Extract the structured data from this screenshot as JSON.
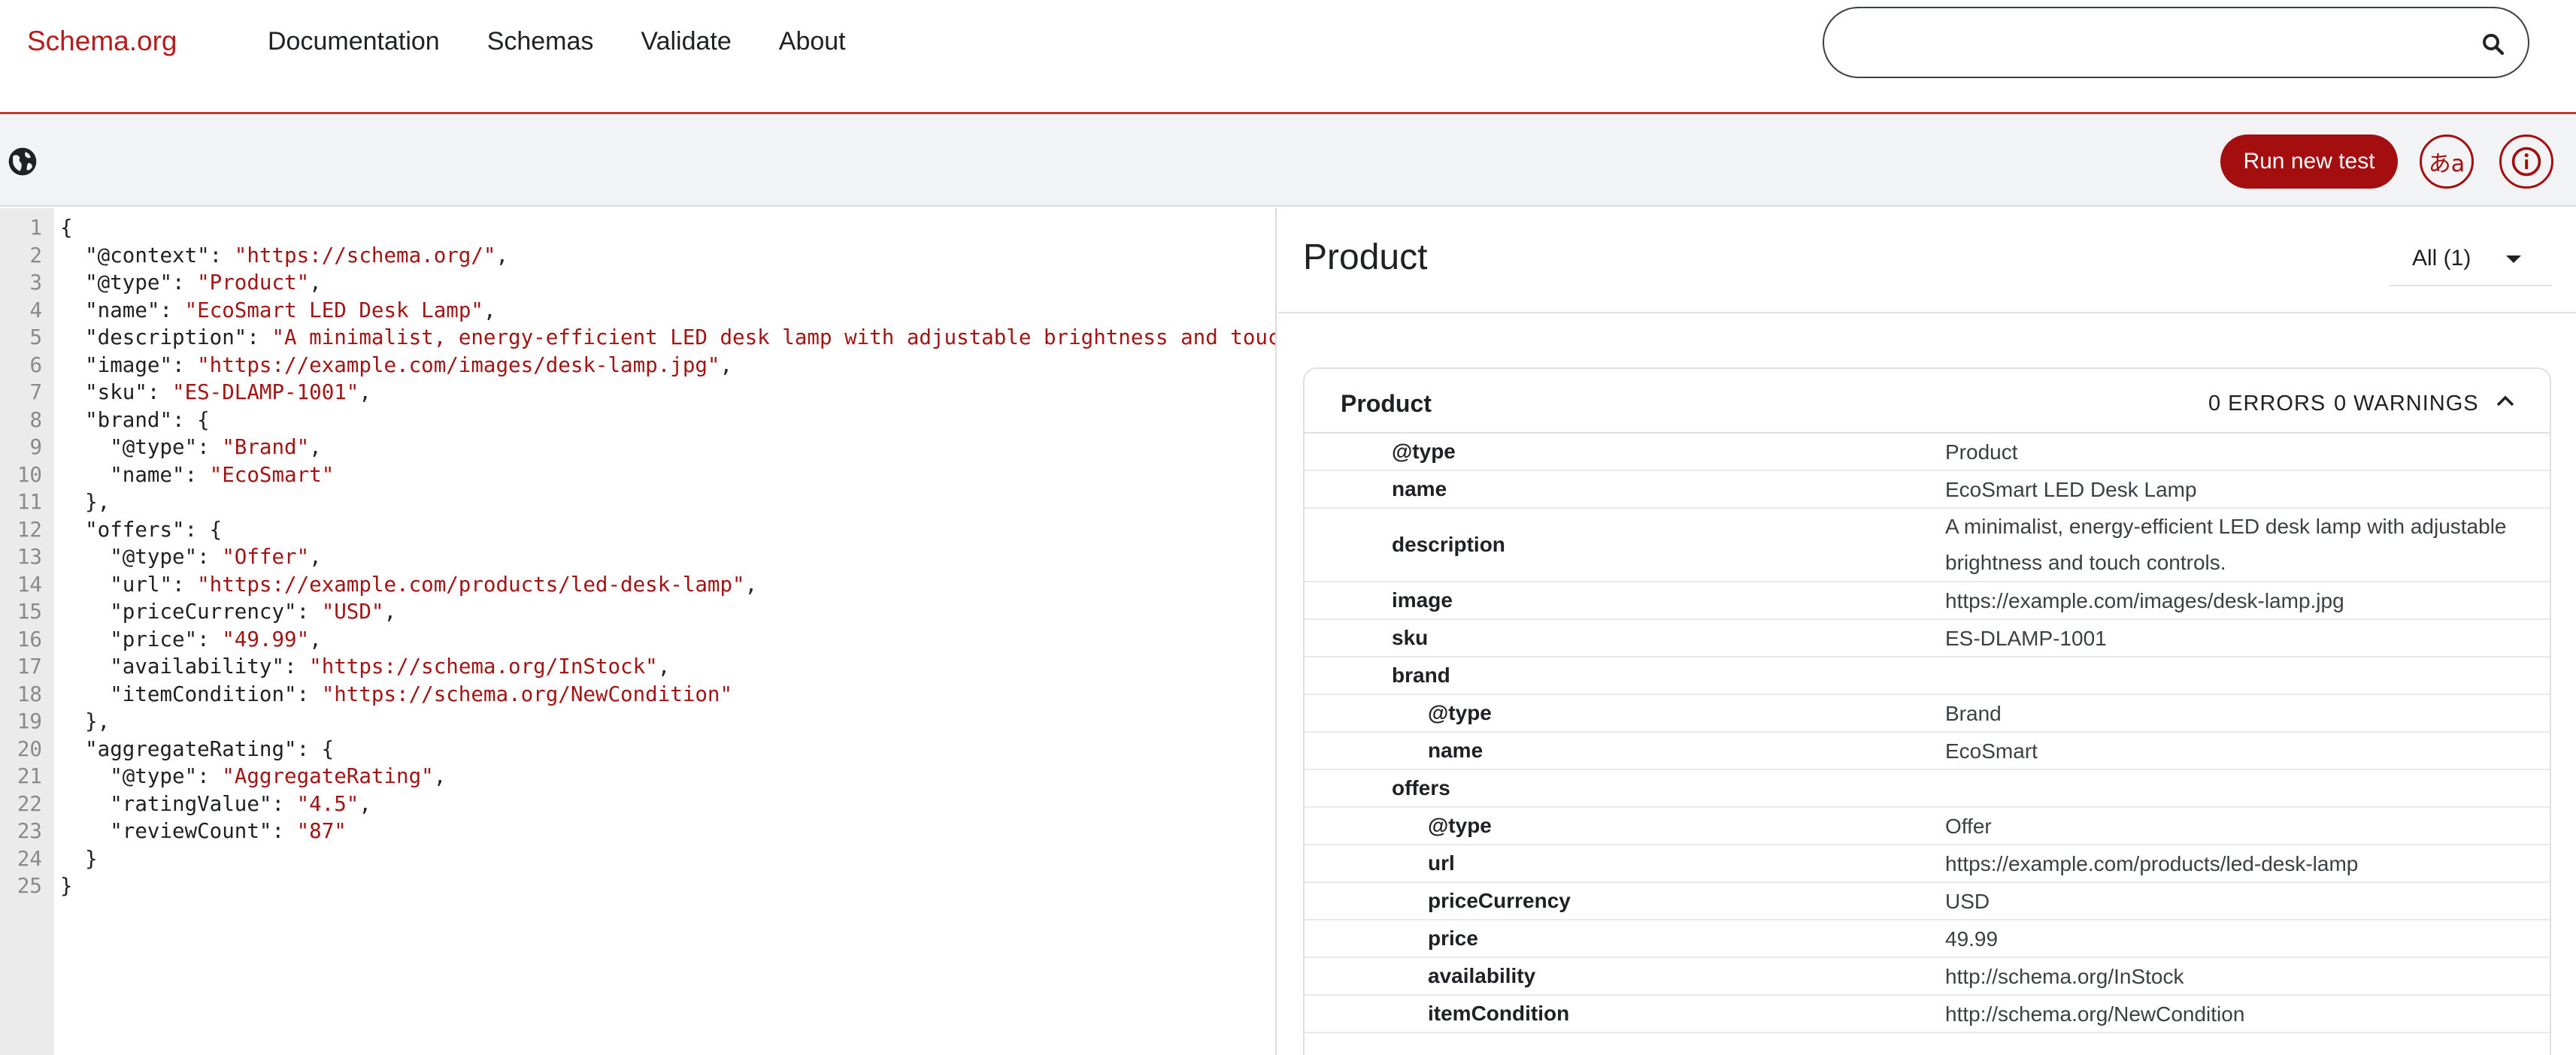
{
  "nav": {
    "logo": "Schema.org",
    "links": [
      "Documentation",
      "Schemas",
      "Validate",
      "About"
    ],
    "search_value": ""
  },
  "toolbar": {
    "run_label": "Run new test",
    "lang_glyph": "あa",
    "icons": [
      "globe-icon",
      "language-icon",
      "info-icon",
      "search-icon"
    ]
  },
  "colors": {
    "brand": "#a50e0e",
    "nav_border": "#c0392b",
    "string": "#a31515"
  },
  "editor": {
    "lines": [
      [
        [
          "p",
          "{"
        ]
      ],
      [
        [
          "p",
          "  \"@context\": "
        ],
        [
          "s",
          "\"https://schema.org/\""
        ],
        [
          "p",
          ","
        ]
      ],
      [
        [
          "p",
          "  \"@type\": "
        ],
        [
          "s",
          "\"Product\""
        ],
        [
          "p",
          ","
        ]
      ],
      [
        [
          "p",
          "  \"name\": "
        ],
        [
          "s",
          "\"EcoSmart LED Desk Lamp\""
        ],
        [
          "p",
          ","
        ]
      ],
      [
        [
          "p",
          "  \"description\": "
        ],
        [
          "s",
          "\"A minimalist, energy-efficient LED desk lamp with adjustable brightness and touch controls.\""
        ],
        [
          "p",
          ","
        ]
      ],
      [
        [
          "p",
          "  \"image\": "
        ],
        [
          "s",
          "\"https://example.com/images/desk-lamp.jpg\""
        ],
        [
          "p",
          ","
        ]
      ],
      [
        [
          "p",
          "  \"sku\": "
        ],
        [
          "s",
          "\"ES-DLAMP-1001\""
        ],
        [
          "p",
          ","
        ]
      ],
      [
        [
          "p",
          "  \"brand\": {"
        ]
      ],
      [
        [
          "p",
          "    \"@type\": "
        ],
        [
          "s",
          "\"Brand\""
        ],
        [
          "p",
          ","
        ]
      ],
      [
        [
          "p",
          "    \"name\": "
        ],
        [
          "s",
          "\"EcoSmart\""
        ]
      ],
      [
        [
          "p",
          "  },"
        ]
      ],
      [
        [
          "p",
          "  \"offers\": {"
        ]
      ],
      [
        [
          "p",
          "    \"@type\": "
        ],
        [
          "s",
          "\"Offer\""
        ],
        [
          "p",
          ","
        ]
      ],
      [
        [
          "p",
          "    \"url\": "
        ],
        [
          "s",
          "\"https://example.com/products/led-desk-lamp\""
        ],
        [
          "p",
          ","
        ]
      ],
      [
        [
          "p",
          "    \"priceCurrency\": "
        ],
        [
          "s",
          "\"USD\""
        ],
        [
          "p",
          ","
        ]
      ],
      [
        [
          "p",
          "    \"price\": "
        ],
        [
          "s",
          "\"49.99\""
        ],
        [
          "p",
          ","
        ]
      ],
      [
        [
          "p",
          "    \"availability\": "
        ],
        [
          "s",
          "\"https://schema.org/InStock\""
        ],
        [
          "p",
          ","
        ]
      ],
      [
        [
          "p",
          "    \"itemCondition\": "
        ],
        [
          "s",
          "\"https://schema.org/NewCondition\""
        ]
      ],
      [
        [
          "p",
          "  },"
        ]
      ],
      [
        [
          "p",
          "  \"aggregateRating\": {"
        ]
      ],
      [
        [
          "p",
          "    \"@type\": "
        ],
        [
          "s",
          "\"AggregateRating\""
        ],
        [
          "p",
          ","
        ]
      ],
      [
        [
          "p",
          "    \"ratingValue\": "
        ],
        [
          "s",
          "\"4.5\""
        ],
        [
          "p",
          ","
        ]
      ],
      [
        [
          "p",
          "    \"reviewCount\": "
        ],
        [
          "s",
          "\"87\""
        ]
      ],
      [
        [
          "p",
          "  }"
        ]
      ],
      [
        [
          "p",
          "}"
        ]
      ]
    ]
  },
  "result": {
    "title": "Product",
    "filter_label": "All (1)",
    "card": {
      "title": "Product",
      "errors": "0 ERRORS",
      "warnings": "0 WARNINGS",
      "rows": [
        {
          "key": "@type",
          "value": "Product",
          "indent": 0
        },
        {
          "key": "name",
          "value": "EcoSmart LED Desk Lamp",
          "indent": 0
        },
        {
          "key": "description",
          "value": "A minimalist, energy-efficient LED desk lamp with adjustable brightness and touch controls.",
          "indent": 0,
          "tall": true
        },
        {
          "key": "image",
          "value": "https://example.com/images/desk-lamp.jpg",
          "indent": 0
        },
        {
          "key": "sku",
          "value": "ES-DLAMP-1001",
          "indent": 0
        },
        {
          "key": "brand",
          "value": "",
          "indent": 0
        },
        {
          "key": "@type",
          "value": "Brand",
          "indent": 1
        },
        {
          "key": "name",
          "value": "EcoSmart",
          "indent": 1
        },
        {
          "key": "offers",
          "value": "",
          "indent": 0
        },
        {
          "key": "@type",
          "value": "Offer",
          "indent": 1
        },
        {
          "key": "url",
          "value": "https://example.com/products/led-desk-lamp",
          "indent": 1
        },
        {
          "key": "priceCurrency",
          "value": "USD",
          "indent": 1
        },
        {
          "key": "price",
          "value": "49.99",
          "indent": 1
        },
        {
          "key": "availability",
          "value": "http://schema.org/InStock",
          "indent": 1
        },
        {
          "key": "itemCondition",
          "value": "http://schema.org/NewCondition",
          "indent": 1
        }
      ]
    }
  }
}
